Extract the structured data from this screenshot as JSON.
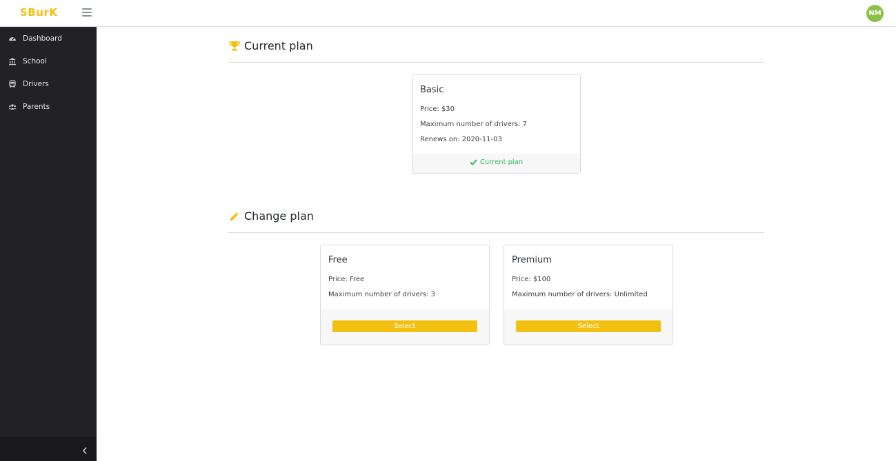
{
  "app": {
    "brand": "SBurK",
    "avatar_initials": "NM"
  },
  "colors": {
    "brand": "#f2c010",
    "sidebar_bg": "#222226",
    "avatar_bg": "#8ac249",
    "success": "#2eb85c"
  },
  "sidebar": {
    "items": [
      {
        "label": "Dashboard",
        "icon": "speedometer-icon"
      },
      {
        "label": "School",
        "icon": "bank-icon"
      },
      {
        "label": "Drivers",
        "icon": "bus-icon"
      },
      {
        "label": "Parents",
        "icon": "people-icon"
      }
    ]
  },
  "current_section": {
    "title": "Current plan",
    "icon": "trophy-icon",
    "plan": {
      "name": "Basic",
      "price": "Price: $30",
      "max_drivers": "Maximum number of drivers: 7",
      "renews": "Renews on: 2020-11-03",
      "status": "Current plan"
    }
  },
  "change_section": {
    "title": "Change plan",
    "icon": "pencil-icon",
    "plans": [
      {
        "name": "Free",
        "price": "Price: Free",
        "max_drivers": "Maximum number of drivers: 3",
        "button": "Select"
      },
      {
        "name": "Premium",
        "price": "Price: $100",
        "max_drivers": "Maximum number of drivers: Unlimited",
        "button": "Select"
      }
    ]
  }
}
